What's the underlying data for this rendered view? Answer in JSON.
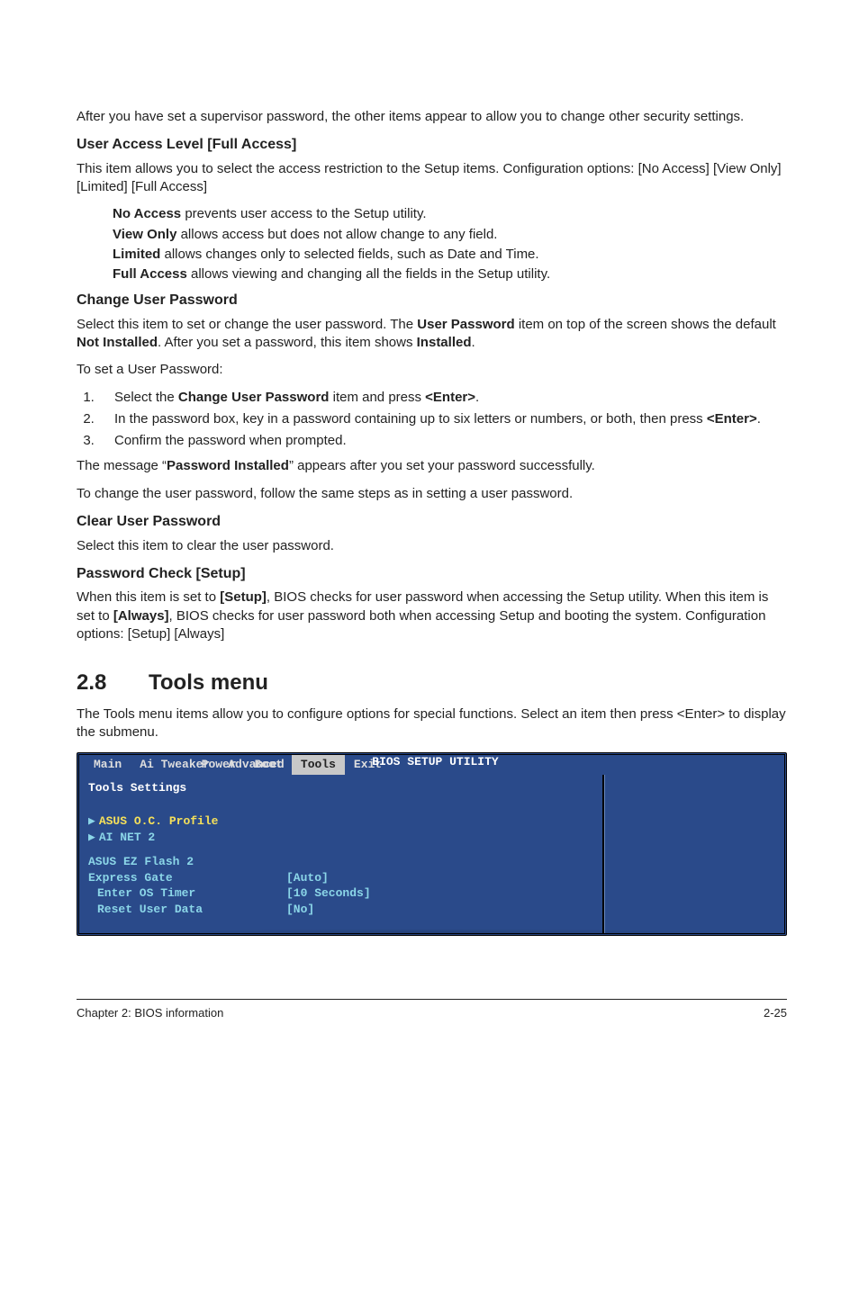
{
  "intro": "After you have set a supervisor password, the other items appear to allow you to change other security settings.",
  "ual": {
    "heading": "User Access Level [Full Access]",
    "desc": "This item allows you to select the access restriction to the Setup items. Configuration options: [No Access] [View Only] [Limited] [Full Access]",
    "noaccess_b": "No Access",
    "noaccess_t": " prevents user access to the Setup utility.",
    "viewonly_b": "View Only",
    "viewonly_t": " allows access but does not allow change to any field.",
    "limited_b": "Limited",
    "limited_t": " allows changes only to selected fields, such as Date and Time.",
    "fullaccess_b": "Full Access",
    "fullaccess_t": " allows viewing and changing all the fields in the Setup utility."
  },
  "cup": {
    "heading": "Change User Password",
    "p1a": "Select this item to set or change the user password. The ",
    "p1b": "User Password",
    "p1c": " item on top of the screen shows the default ",
    "p1d": "Not Installed",
    "p1e": ". After you set a password, this item shows ",
    "p1f": "Installed",
    "p1g": ".",
    "p2": "To set a User Password:",
    "s1a": "Select the ",
    "s1b": "Change User Password",
    "s1c": " item and press ",
    "s1d": "<Enter>",
    "s1e": ".",
    "s2a": "In the password box, key in a password containing up to six letters or numbers, or both, then press ",
    "s2b": "<Enter>",
    "s2c": ".",
    "s3": "Confirm the password when prompted.",
    "p3a": "The message “",
    "p3b": "Password Installed",
    "p3c": "” appears after you set your password successfully.",
    "p4": "To change the user password, follow the same steps as in setting a user password."
  },
  "clr": {
    "heading": "Clear User Password",
    "desc": "Select this item to clear the user password."
  },
  "pwc": {
    "heading": "Password Check [Setup]",
    "a": "When this item is set to ",
    "b": "[Setup]",
    "c": ", BIOS checks for user password when accessing the Setup utility. When this item is set to ",
    "d": "[Always]",
    "e": ", BIOS checks for user password both when accessing Setup and booting the system. Configuration options: [Setup] [Always]"
  },
  "tools": {
    "secno": "2.8",
    "title": "Tools menu",
    "desc": "The Tools menu items allow you to configure options for special functions. Select an item then press <Enter> to display the submenu."
  },
  "bios": {
    "title": "BIOS SETUP UTILITY",
    "tabs": {
      "main": "Main",
      "ai": "Ai Tweaker",
      "adv": "Advanced",
      "power": "Power",
      "boot": "Boot",
      "tools": "Tools",
      "exit": "Exit"
    },
    "hdr": "Tools Settings",
    "items": {
      "oc": "ASUS O.C. Profile",
      "ainet": "AI NET 2",
      "ezflash": "ASUS EZ Flash 2",
      "express": "Express Gate",
      "express_v": "[Auto]",
      "enteros": "Enter OS Timer",
      "enteros_v": "[10 Seconds]",
      "reset": "Reset User Data",
      "reset_v": "[No]"
    }
  },
  "footer": {
    "left": "Chapter 2: BIOS information",
    "right": "2-25"
  }
}
